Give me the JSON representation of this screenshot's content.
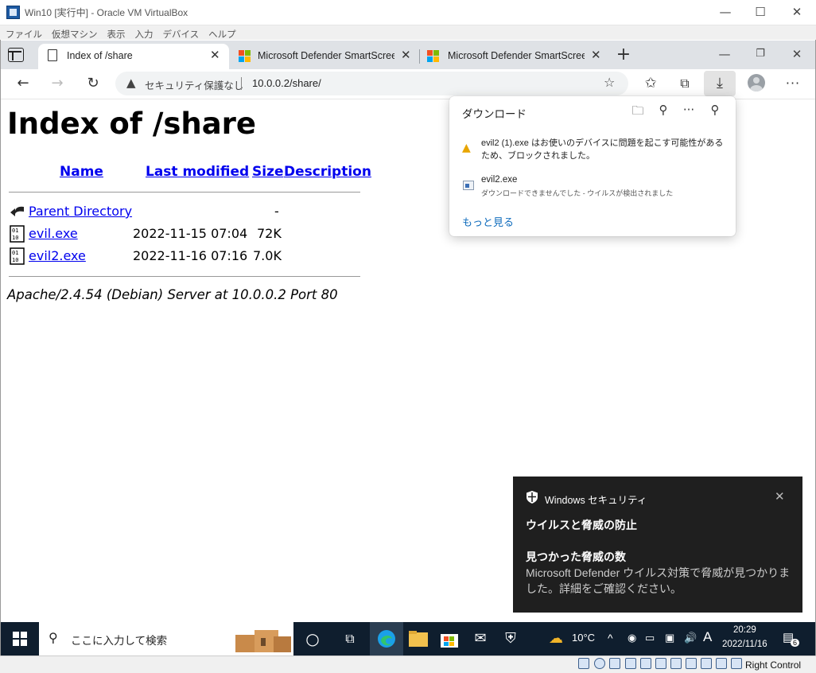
{
  "host_window": {
    "title": "Win10 [実行中] - Oracle VM VirtualBox",
    "menu": [
      "ファイル",
      "仮想マシン",
      "表示",
      "入力",
      "デバイス",
      "ヘルプ"
    ],
    "minimize_icon": "minimize-icon",
    "maximize_icon": "maximize-icon",
    "close_icon": "close-icon"
  },
  "browser": {
    "tabs": [
      {
        "label": "Index of /share",
        "active": true
      },
      {
        "label": "Microsoft Defender SmartScreen",
        "active": false
      },
      {
        "label": "Microsoft Defender SmartScreen",
        "active": false
      }
    ],
    "address": {
      "security_label": "セキュリティ保護なし",
      "url": "10.0.0.2/share/"
    }
  },
  "page": {
    "heading": "Index of /share",
    "columns": [
      "Name",
      "Last modified",
      "Size",
      "Description"
    ],
    "rows": [
      {
        "name": "Parent Directory",
        "modified": "",
        "size": "-",
        "icon": "back-arrow-icon"
      },
      {
        "name": "evil.exe",
        "modified": "2022-11-15 07:04",
        "size": "72K",
        "icon": "binary-file-icon"
      },
      {
        "name": "evil2.exe",
        "modified": "2022-11-16 07:16",
        "size": "7.0K",
        "icon": "binary-file-icon"
      }
    ],
    "footer": "Apache/2.4.54 (Debian) Server at 10.0.0.2 Port 80"
  },
  "downloads": {
    "title": "ダウンロード",
    "warning": "evil2 (1).exe はお使いのデバイスに問題を起こす可能性があるため、ブロックされました。",
    "file_name": "evil2.exe",
    "file_status": "ダウンロードできませんでした - ウイルスが検出されました",
    "more_link": "もっと見る"
  },
  "toast": {
    "app_name": "Windows セキュリティ",
    "heading": "ウイルスと脅威の防止",
    "subheading": "見つかった脅威の数",
    "body": "Microsoft Defender ウイルス対策で脅威が見つかりました。詳細をご確認ください。"
  },
  "taskbar": {
    "search_placeholder": "ここに入力して検索",
    "weather_temp": "10°C",
    "ime_indicator": "A",
    "time": "20:29",
    "date": "2022/11/16",
    "notification_count": "6"
  },
  "vbox_status": {
    "host_key": "Right Control"
  },
  "colors": {
    "link": "#0000ee",
    "taskbar": "#0f1e2e",
    "toast_bg": "#1f1f1f",
    "edge_accent": "#0f6cbd"
  }
}
